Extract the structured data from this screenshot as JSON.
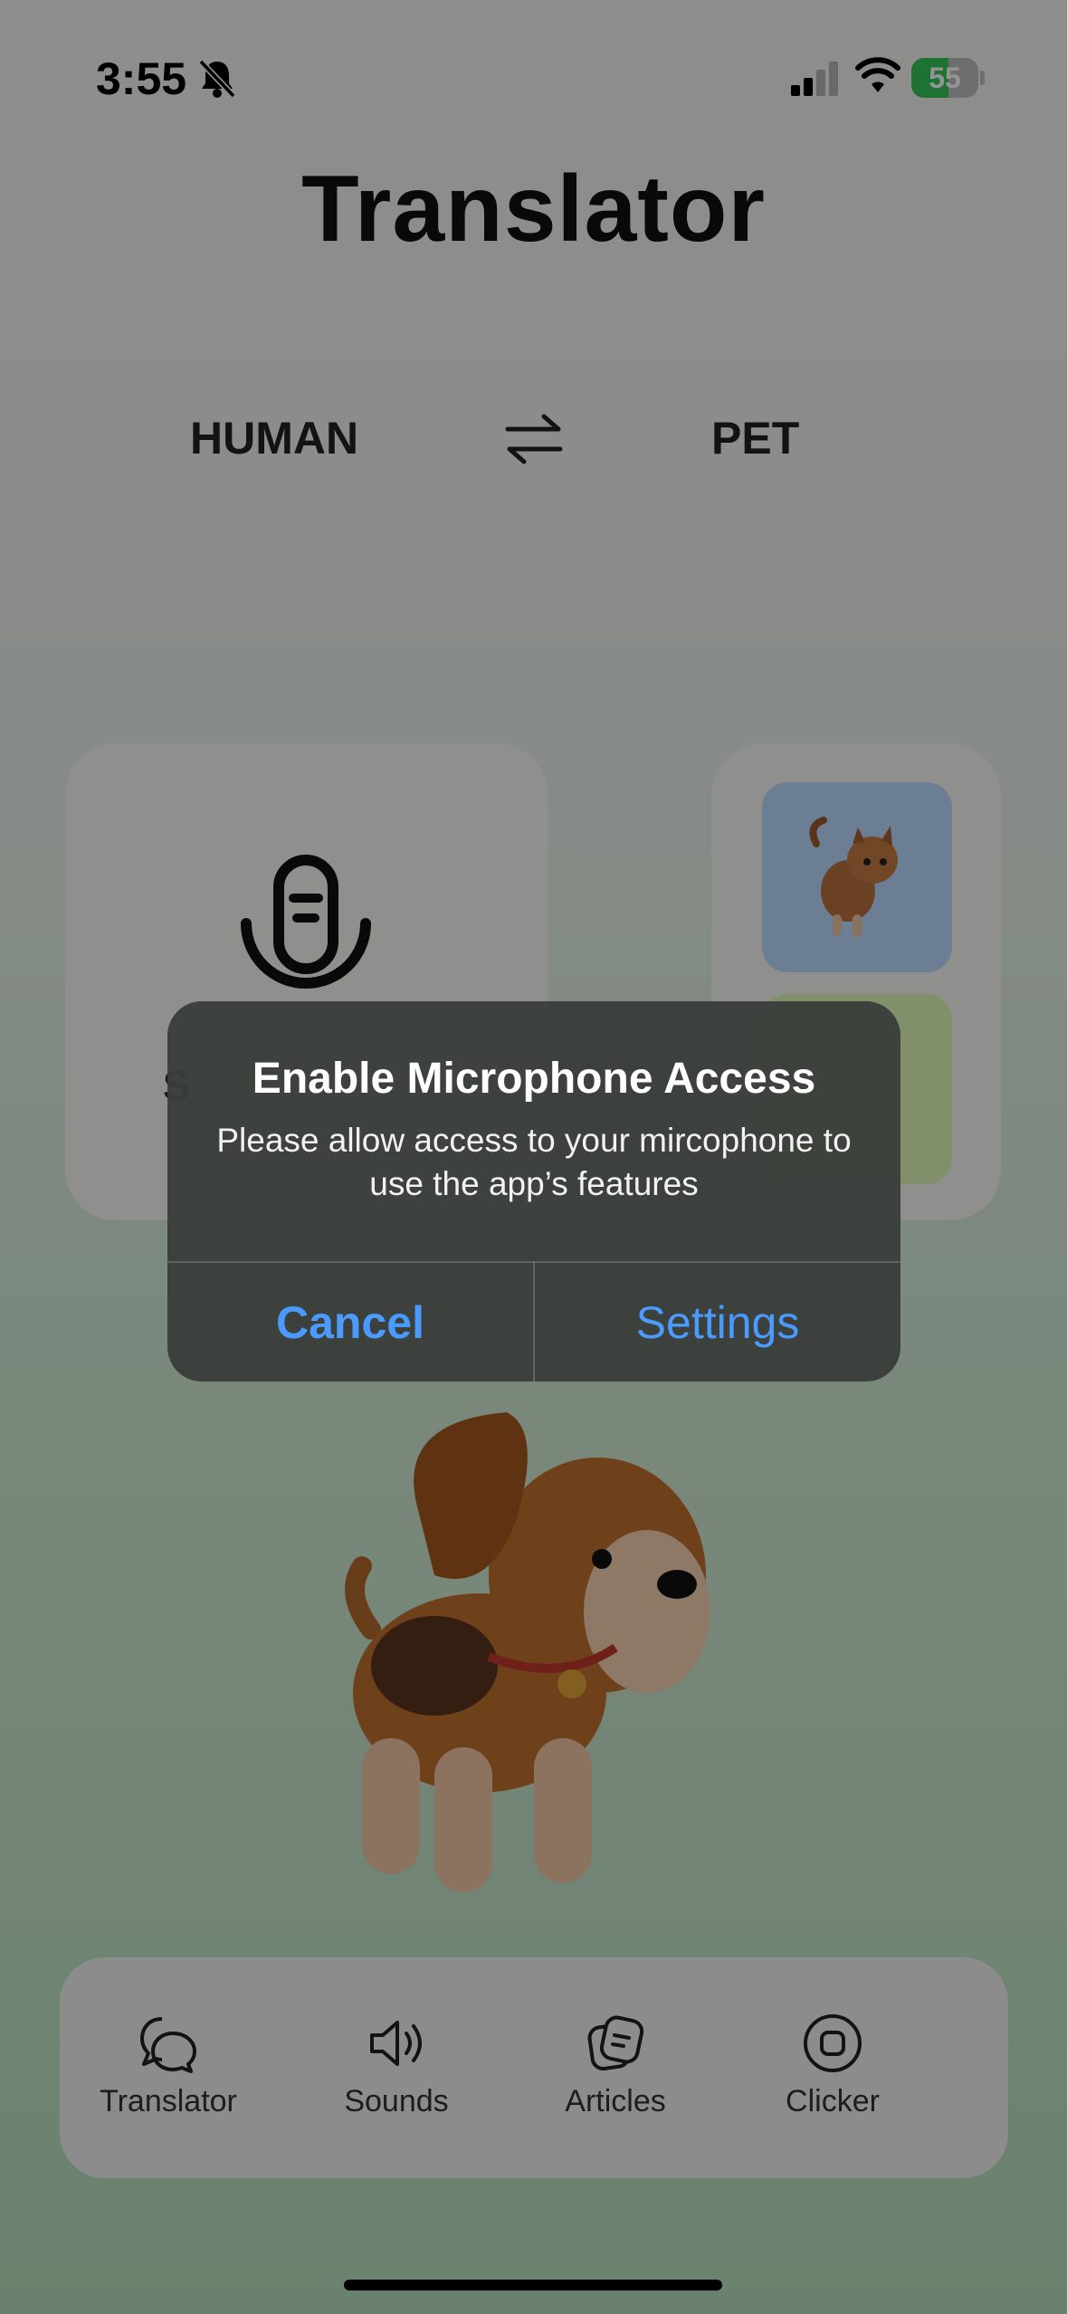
{
  "status_bar": {
    "time": "3:55",
    "battery_percent": "55",
    "battery_level": 0.55
  },
  "title": "Translator",
  "language": {
    "from": "HUMAN",
    "to": "PET"
  },
  "mic_card": {
    "label": "S"
  },
  "alert": {
    "title": "Enable Microphone Access",
    "message": "Please allow access to your mircophone to use the app’s features",
    "cancel": "Cancel",
    "settings": "Settings"
  },
  "tabs": [
    {
      "label": "Translator",
      "icon": "chat-bubbles-icon"
    },
    {
      "label": "Sounds",
      "icon": "speaker-icon"
    },
    {
      "label": "Articles",
      "icon": "articles-icon"
    },
    {
      "label": "Clicker",
      "icon": "clicker-icon"
    }
  ],
  "colors": {
    "accent": "#4b9bff",
    "battery": "#34c759"
  }
}
